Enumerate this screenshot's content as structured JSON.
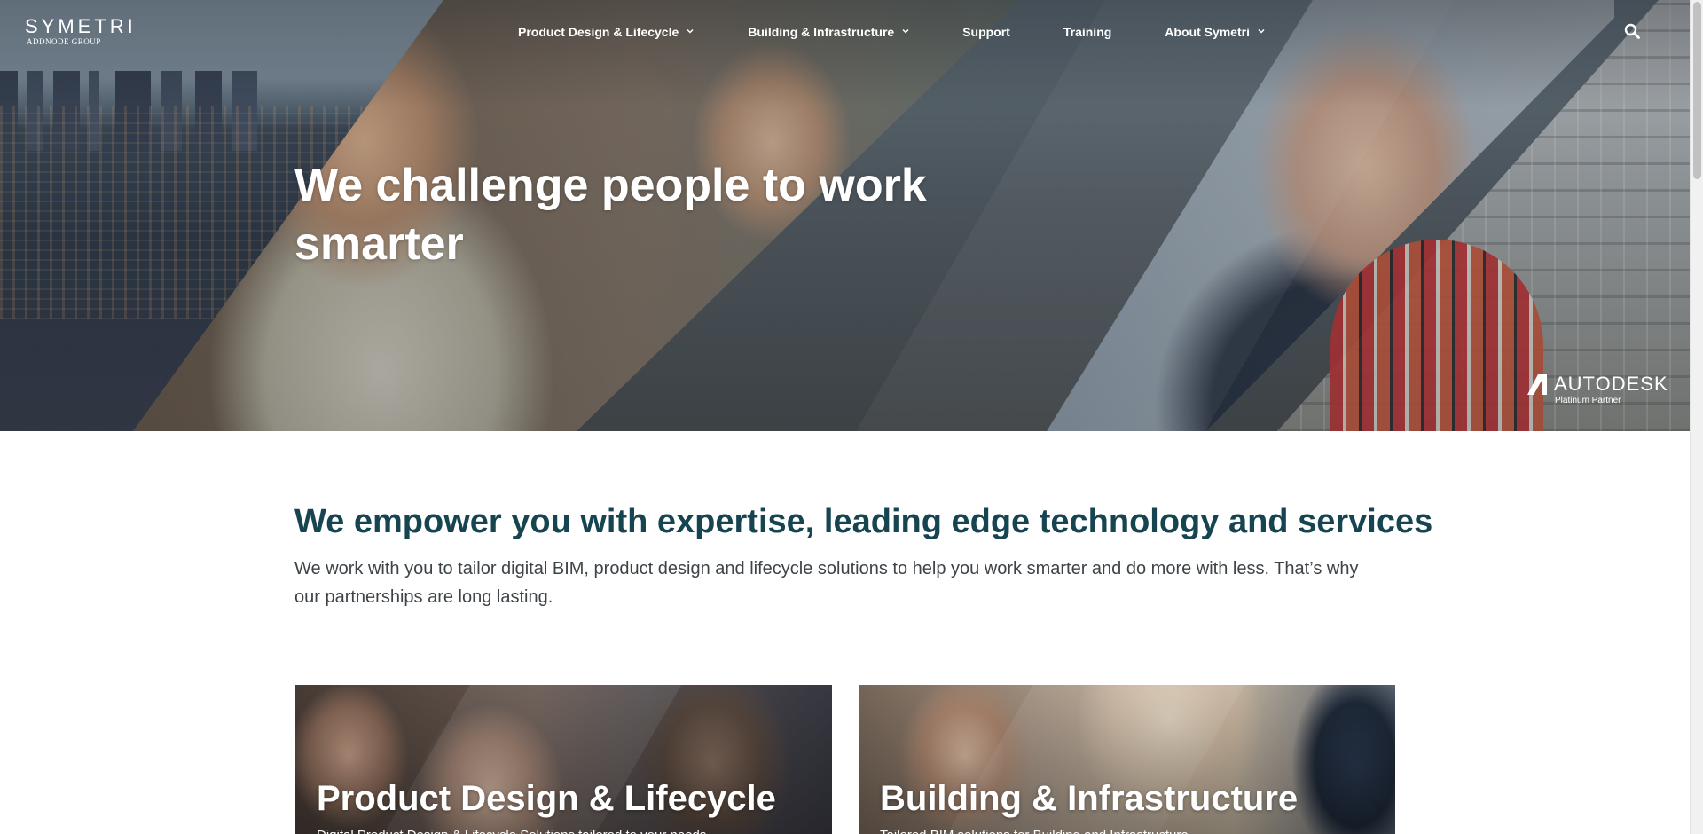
{
  "header": {
    "logo": {
      "brand": "SYMETRI",
      "sub": "ADDNODE GROUP"
    },
    "nav": [
      {
        "label": "Product Design & Lifecycle",
        "dropdown": true
      },
      {
        "label": "Building & Infrastructure",
        "dropdown": true
      },
      {
        "label": "Support",
        "dropdown": false
      },
      {
        "label": "Training",
        "dropdown": false
      },
      {
        "label": "About Symetri",
        "dropdown": true
      }
    ],
    "search_icon": "search-icon"
  },
  "hero": {
    "title": "We challenge people to work smarter",
    "partner": {
      "name": "AUTODESK",
      "tier": "Platinum Partner"
    }
  },
  "intro": {
    "title": "We empower you with expertise, leading edge technology and services",
    "text": "We work with you to tailor digital BIM, product design and lifecycle solutions to help you work smarter and do more with less. That’s why our partnerships are long lasting."
  },
  "cards": [
    {
      "title": "Product Design & Lifecycle",
      "desc": "Digital Product Design & Lifecycle Solutions tailored to your needs"
    },
    {
      "title": "Building & Infrastructure",
      "desc": "Tailored BIM solutions for Building and Infrastructure"
    }
  ],
  "colors": {
    "heading": "#164451",
    "body_text": "#3d4448",
    "nav_text": "#ffffff"
  }
}
